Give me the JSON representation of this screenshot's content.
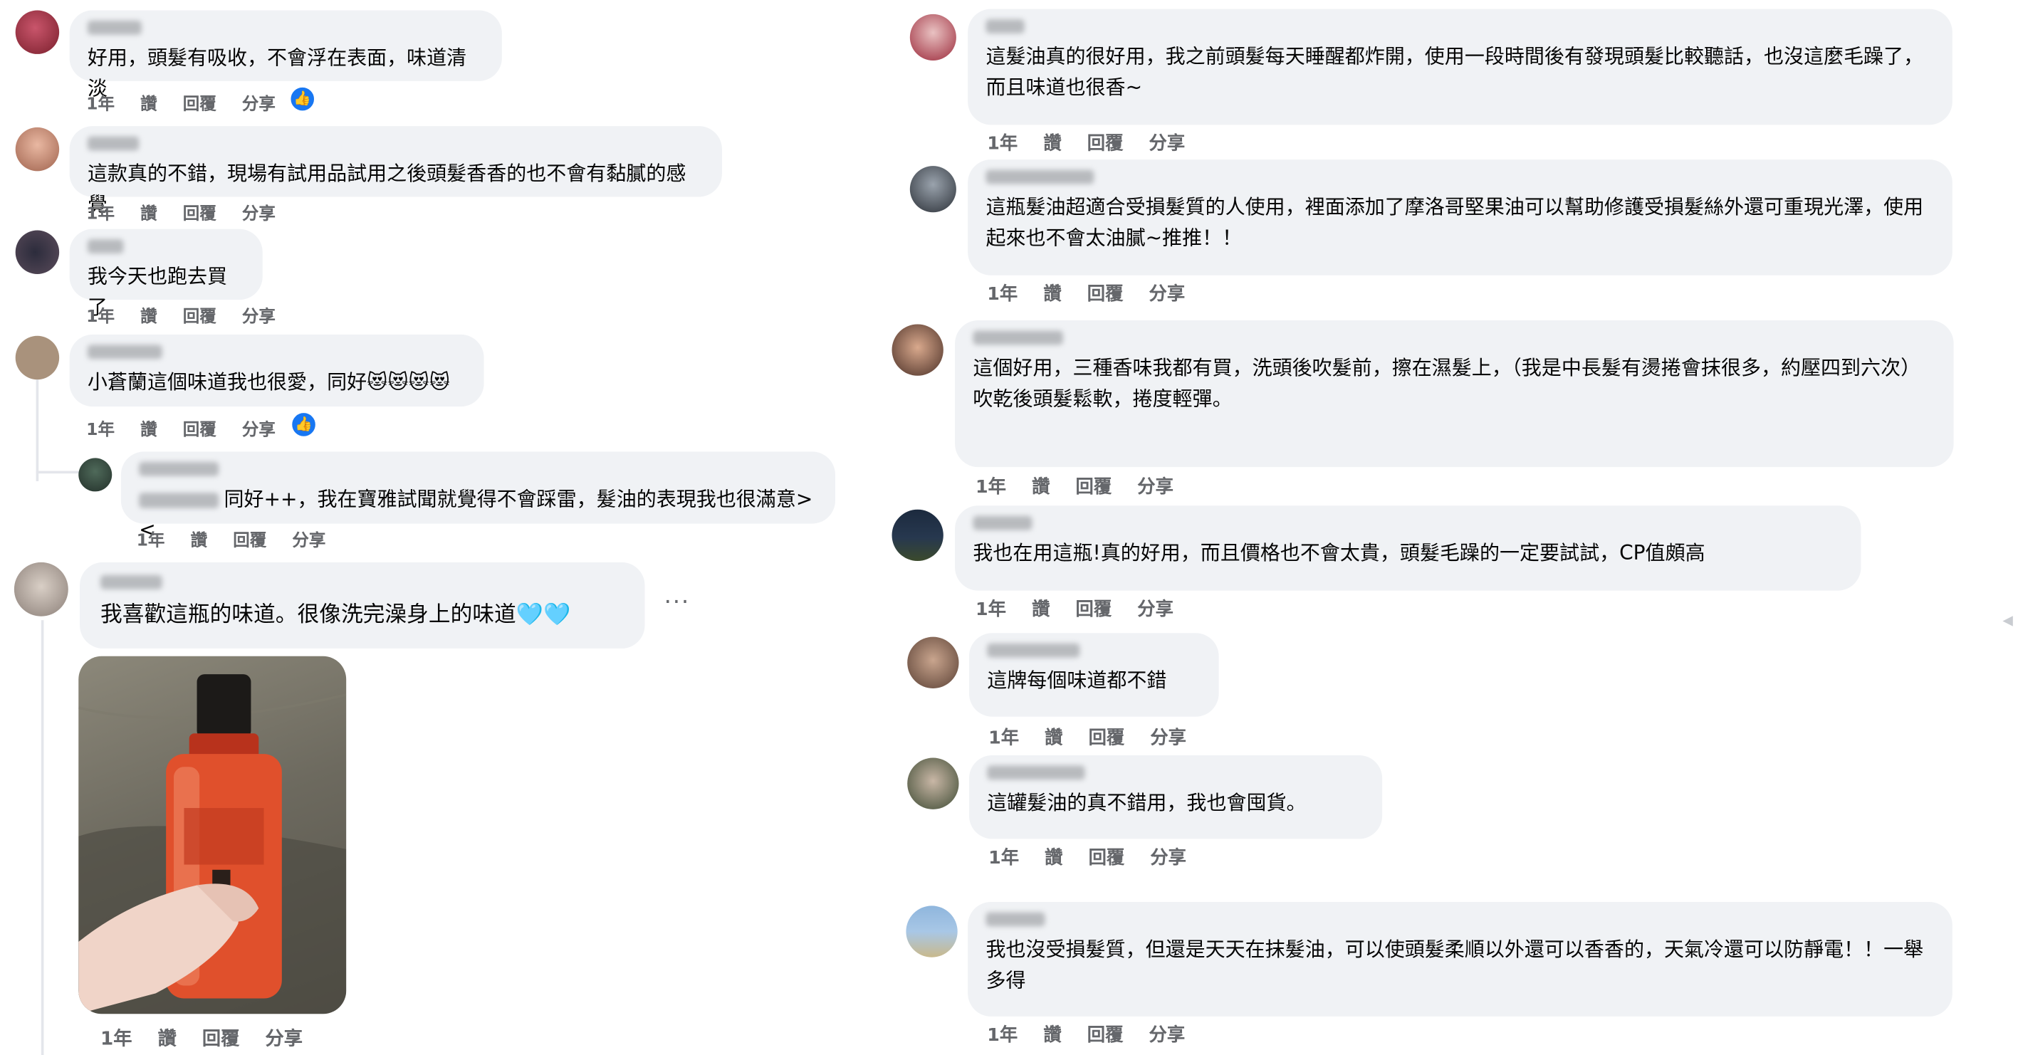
{
  "actions": {
    "time": "1年",
    "like": "讚",
    "reply": "回覆",
    "share": "分享"
  },
  "left_comments": [
    {
      "text": "好用，頭髮有吸收，不會浮在表面，味道清淡"
    },
    {
      "text": "這款真的不錯，現場有試用品試用之後頭髮香香的也不會有黏膩的感覺"
    },
    {
      "text": "我今天也跑去買了"
    },
    {
      "text": "小蒼蘭這個味道我也很愛，同好😻😻😻😻"
    },
    {
      "text": "同好++，我在寶雅試聞就覺得不會踩雷，髮油的表現我也很滿意><"
    },
    {
      "text": "我喜歡這瓶的味道。很像洗完澡身上的味道🩵🩵"
    }
  ],
  "right_comments": [
    {
      "text": "這髮油真的很好用，我之前頭髮每天睡醒都炸開，使用一段時間後有發現頭髮比較聽話，也沒這麼毛躁了，而且味道也很香~"
    },
    {
      "text": "這瓶髮油超適合受損髮質的人使用，裡面添加了摩洛哥堅果油可以幫助修護受損髮絲外還可重現光澤，使用起來也不會太油膩~推推！！"
    },
    {
      "text": "這個好用，三種香味我都有買，洗頭後吹髮前，擦在濕髮上，（我是中長髮有燙捲會抹很多，約壓四到六次）\n吹乾後頭髮鬆軟，捲度輕彈。"
    },
    {
      "text": "我也在用這瓶!真的好用，而且價格也不會太貴，頭髮毛躁的一定要試試，CP值頗高"
    },
    {
      "text": "這牌每個味道都不錯"
    },
    {
      "text": "這罐髮油的真不錯用，我也會囤貨。"
    },
    {
      "text": "我也沒受損髮質，但還是天天在抹髮油，可以使頭髮柔順以外還可以香香的，天氣冷還可以防靜電！！一舉多得"
    }
  ],
  "colors": {
    "bubble": "#f0f2f5",
    "meta": "#65676b",
    "like_blue": "#1877f2"
  },
  "icons": {
    "like": "thumbs-up-icon",
    "more": "more-options-icon"
  }
}
